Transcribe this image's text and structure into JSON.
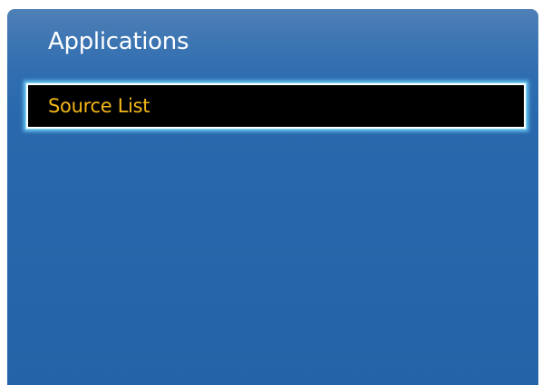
{
  "menu": {
    "title": "Applications",
    "items": [
      {
        "label": "Source List",
        "selected": true
      }
    ]
  },
  "colors": {
    "background": "#2563a8",
    "highlight": "#000000",
    "selected_text": "#f4b618",
    "focus_glow": "#7fd6f5"
  }
}
